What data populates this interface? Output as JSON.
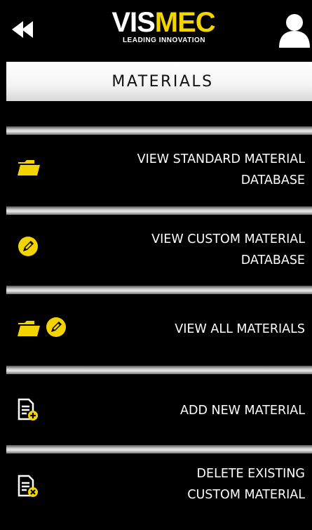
{
  "header": {
    "back_icon": "double-chevron-left-icon",
    "logo": {
      "word_left": "VIS",
      "word_right": "MEC",
      "tagline": "LEADING INNOVATION"
    },
    "user_icon": "user-icon"
  },
  "title": "MATERIALS",
  "colors": {
    "accent": "#f4d400",
    "background": "#000000",
    "title_bar": "#f4f4f4"
  },
  "menu": [
    {
      "line1": "VIEW STANDARD MATERIAL",
      "line2": "DATABASE",
      "icon": "folder-icon"
    },
    {
      "line1": "VIEW CUSTOM MATERIAL",
      "line2": "DATABASE",
      "icon": "pencil-icon"
    },
    {
      "line1": "VIEW ALL MATERIALS",
      "line2": "",
      "icon": "folder-pencil-icon"
    },
    {
      "line1": "ADD NEW MATERIAL",
      "line2": "",
      "icon": "add-document-icon"
    },
    {
      "line1": "DELETE EXISTING",
      "line2": "CUSTOM MATERIAL",
      "icon": "delete-document-icon"
    }
  ]
}
